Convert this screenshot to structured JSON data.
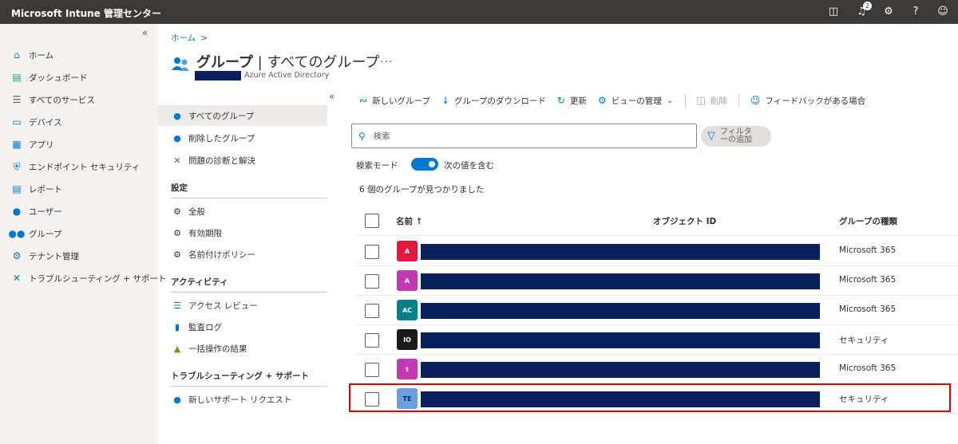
{
  "topbar": {
    "title": "Microsoft Intune 管理センター",
    "notification_count": "2",
    "icons": [
      "screen-share-icon",
      "bell-icon",
      "gear-icon",
      "help-icon",
      "feedback-icon"
    ]
  },
  "leftnav": {
    "items": [
      {
        "label": "ホーム",
        "icon": "home-icon"
      },
      {
        "label": "ダッシュボード",
        "icon": "dashboard-icon"
      },
      {
        "label": "すべてのサービス",
        "icon": "list-icon"
      },
      {
        "label": "デバイス",
        "icon": "devices-icon"
      },
      {
        "label": "アプリ",
        "icon": "apps-icon"
      },
      {
        "label": "エンドポイント セキュリティ",
        "icon": "shield-icon"
      },
      {
        "label": "レポート",
        "icon": "report-icon"
      },
      {
        "label": "ユーザー",
        "icon": "user-icon"
      },
      {
        "label": "グループ",
        "icon": "group-icon"
      },
      {
        "label": "テナント管理",
        "icon": "tenant-icon"
      },
      {
        "label": "トラブルシューティング + サポート",
        "icon": "wrench-icon"
      }
    ]
  },
  "breadcrumb": {
    "home": "ホーム",
    "sep": ">"
  },
  "header": {
    "title_bold": "グループ",
    "title_rest": " | すべてのグループ",
    "more": "...",
    "subtitle": "Azure Active Directory"
  },
  "menu2": {
    "items": [
      {
        "label": "すべてのグループ"
      },
      {
        "label": "削除したグループ"
      },
      {
        "label": "問題の診断と解決"
      }
    ],
    "settings_head": "設定",
    "settings": [
      {
        "label": "全般"
      },
      {
        "label": "有効期限"
      },
      {
        "label": "名前付けポリシー"
      }
    ],
    "activity_head": "アクティビティ",
    "activity": [
      {
        "label": "アクセス レビュー"
      },
      {
        "label": "監査ログ"
      },
      {
        "label": "一括操作の結果"
      }
    ],
    "support_head": "トラブルシューティング + サポート",
    "support": [
      {
        "label": "新しいサポート リクエスト"
      }
    ]
  },
  "toolbar": {
    "new_group": "新しいグループ",
    "download": "グループのダウンロード",
    "refresh": "更新",
    "manage_view": "ビューの管理",
    "delete": "削除",
    "feedback": "フィードバックがある場合"
  },
  "search": {
    "placeholder": "検索"
  },
  "filter": {
    "line1": "フィルタ",
    "line2": "ーの追加"
  },
  "search_mode": {
    "label": "検索モード",
    "toggle_text": "次の値を含む"
  },
  "result_count": "6 個のグループが見つかりました",
  "table": {
    "headers": {
      "name": "名前 ↑",
      "object_id": "オブジェクト ID",
      "group_type": "グループの種類"
    },
    "rows": [
      {
        "initials": "A",
        "color": "#e3173e",
        "type": "Microsoft 365"
      },
      {
        "initials": "A",
        "color": "#c239b3",
        "type": "Microsoft 365"
      },
      {
        "initials": "AC",
        "color": "#038387",
        "type": "Microsoft 365"
      },
      {
        "initials": "IO",
        "color": "#1b1a19",
        "type": "セキュリティ"
      },
      {
        "initials": "t",
        "color": "#c239b3",
        "type": "Microsoft 365"
      },
      {
        "initials": "TE",
        "color": "#6a9ee0",
        "type": "セキュリティ"
      }
    ]
  },
  "colors": {
    "accent": "#0078d4",
    "redaction": "#0b1f5c",
    "highlight": "#e00000"
  }
}
